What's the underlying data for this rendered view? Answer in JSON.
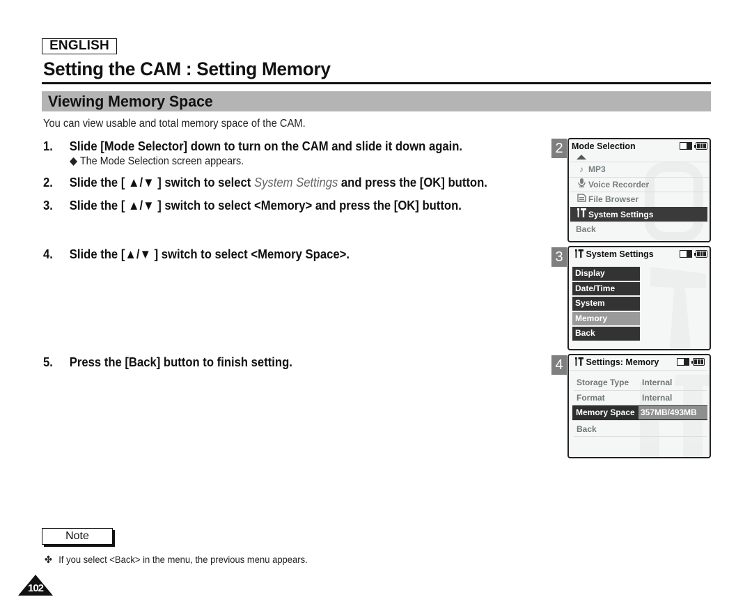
{
  "header": {
    "language": "ENGLISH",
    "page_title": "Setting the CAM : Setting Memory",
    "section_title": "Viewing Memory Space",
    "intro": "You can view usable and total memory space of the CAM."
  },
  "steps": [
    {
      "num": "1.",
      "text": "Slide [Mode Selector] down to turn on the CAM and slide it down again.",
      "sub": "◆ The Mode Selection screen appears."
    },
    {
      "num": "2.",
      "pre": "Slide the [ ▲/▼ ] switch to select ",
      "em": "System Settings",
      "post": " and press the [OK] button."
    },
    {
      "num": "3.",
      "text": "Slide the [ ▲/▼ ] switch to select <Memory> and press the [OK] button."
    },
    {
      "num": "4.",
      "text": "Slide the [▲/▼ ] switch to select <Memory Space>."
    },
    {
      "num": "5.",
      "text": "Press the [Back] button to finish setting."
    }
  ],
  "screens": {
    "s2": {
      "number": "2",
      "title": "Mode Selection",
      "items": [
        {
          "icon": "music-note-icon",
          "glyph": "♪",
          "label": "MP3"
        },
        {
          "icon": "microphone-icon",
          "glyph": "🎙",
          "label": "Voice Recorder"
        },
        {
          "icon": "file-icon",
          "glyph": "▤",
          "label": "File Browser"
        },
        {
          "icon": "settings-tools-icon",
          "glyph": "╁T",
          "label": "System Settings",
          "selected": true
        },
        {
          "label": "Back"
        }
      ]
    },
    "s3": {
      "number": "3",
      "title": "System Settings",
      "items": [
        {
          "label": "Display"
        },
        {
          "label": "Date/Time"
        },
        {
          "label": "System"
        },
        {
          "label": "Memory",
          "selected": true
        },
        {
          "label": "Back"
        }
      ]
    },
    "s4": {
      "number": "4",
      "title": "Settings: Memory",
      "rows": [
        {
          "key": "Storage Type",
          "value": "Internal"
        },
        {
          "key": "Format",
          "value": "Internal"
        },
        {
          "key": "Memory Space",
          "value": "357MB/493MB",
          "selected": true
        },
        {
          "key": "Back",
          "value": ""
        }
      ]
    }
  },
  "note": {
    "label": "Note",
    "bullet": "✤",
    "text": "If you select <Back> in the menu, the previous menu appears."
  },
  "page_number": "102",
  "colors": {
    "section_bar": "#b4b4b4",
    "selected_row": "#3a3a3a",
    "selected_item": "#9a9a9a",
    "screen_num_bg": "#7f7f7f"
  }
}
